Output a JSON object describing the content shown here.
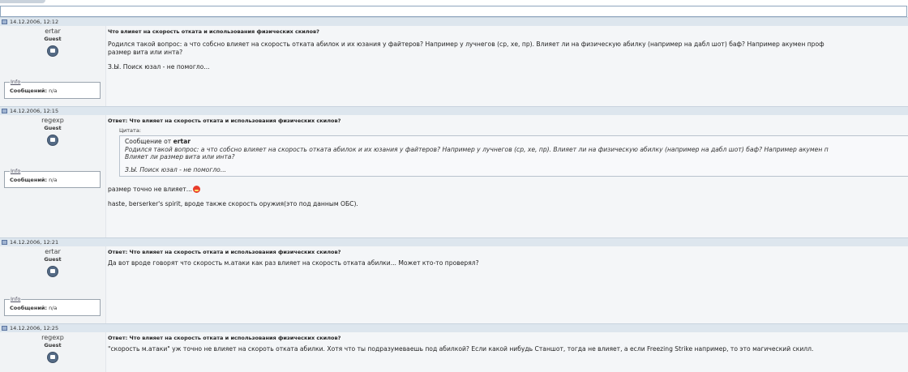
{
  "posts": [
    {
      "date": "14.12.2006, 12:12",
      "username": "ertar",
      "usertitle": "Guest",
      "info_label": "Info",
      "messages_label": "Сообщений:",
      "messages_value": "n/a",
      "title": "Что влияет на скорость отката и использования физических скилов?",
      "lines": [
        "Родился такой вопрос: а что собсно влияет на скорость отката абилок и их юзания у файтеров? Например у лучнегов (ср, хе, пр). Влияет ли на физическую абилку (например на дабл шот) баф? Например акумен проф",
        "размер вита или инта?",
        "",
        "З.Ы. Поиск юзал - не помогло..."
      ]
    },
    {
      "date": "14.12.2006, 12:15",
      "username": "regexp",
      "usertitle": "Guest",
      "info_label": "Info",
      "messages_label": "Сообщений:",
      "messages_value": "n/a",
      "title": "Ответ: Что влияет на скорость отката и использования физических скилов?",
      "quote": {
        "label": "Цитата:",
        "from_prefix": "Сообщение от",
        "from_user": "ertar",
        "lines": [
          "Родился такой вопрос: а что собсно влияет на скорость отката абилок и их юзания у файтеров? Например у лучнегов (ср, хе, пр). Влияет ли на физическую абилку (например на дабл шот) баф? Например акумен п",
          "Влияет ли размер вита или инта?",
          "",
          "З.Ы. Поиск юзал - не помогло..."
        ]
      },
      "line1": "размер точно не влияет...",
      "line2": "haste, berserker's spirit, вроде также скорость оружия(это под данным ОБС)."
    },
    {
      "date": "14.12.2006, 12:21",
      "username": "ertar",
      "usertitle": "Guest",
      "info_label": "Info",
      "messages_label": "Сообщений:",
      "messages_value": "n/a",
      "title": "Ответ: Что влияет на скорость отката и использования физических скилов?",
      "text": "Да вот вроде говорят что скорость м.атаки как раз влияет на скорость отката абилки... Может кто-то проверял?"
    },
    {
      "date": "14.12.2006, 12:25",
      "username": "regexp",
      "usertitle": "Guest",
      "title": "Ответ: Что влияет на скорость отката и использования физических скилов?",
      "text": "\"скорость м.атаки\" уж точно не влияет на скороть отката абилки. Хотя что ты подразумеваешь под абилкой? Если какой нибудь Станшот, тогда не влияет, а если Freezing Strike например, то это магический скилл."
    }
  ]
}
